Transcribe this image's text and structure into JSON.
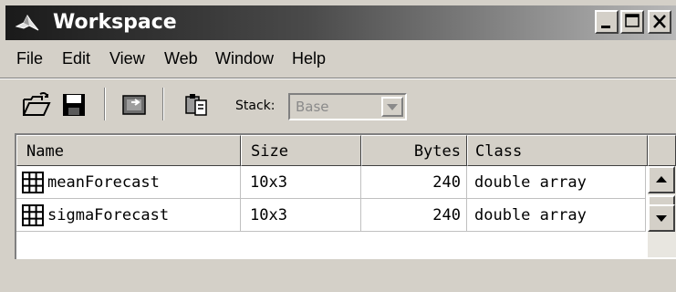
{
  "window": {
    "title": "Workspace"
  },
  "menu": [
    {
      "label": "File"
    },
    {
      "label": "Edit"
    },
    {
      "label": "View"
    },
    {
      "label": "Web"
    },
    {
      "label": "Window"
    },
    {
      "label": "Help"
    }
  ],
  "toolbar": {
    "stack_label": "Stack:",
    "stack_value": "Base"
  },
  "table": {
    "columns": [
      "Name",
      "Size",
      "Bytes",
      "Class"
    ],
    "rows": [
      {
        "name": "meanForecast",
        "size": "10x3",
        "bytes": "240",
        "class": "double array"
      },
      {
        "name": "sigmaForecast",
        "size": "10x3",
        "bytes": "240",
        "class": "double array"
      }
    ]
  },
  "colors": {
    "title_gradient_start": "#1a1a1a",
    "title_gradient_end": "#b8b8b8",
    "chrome": "#d4d0c8"
  }
}
